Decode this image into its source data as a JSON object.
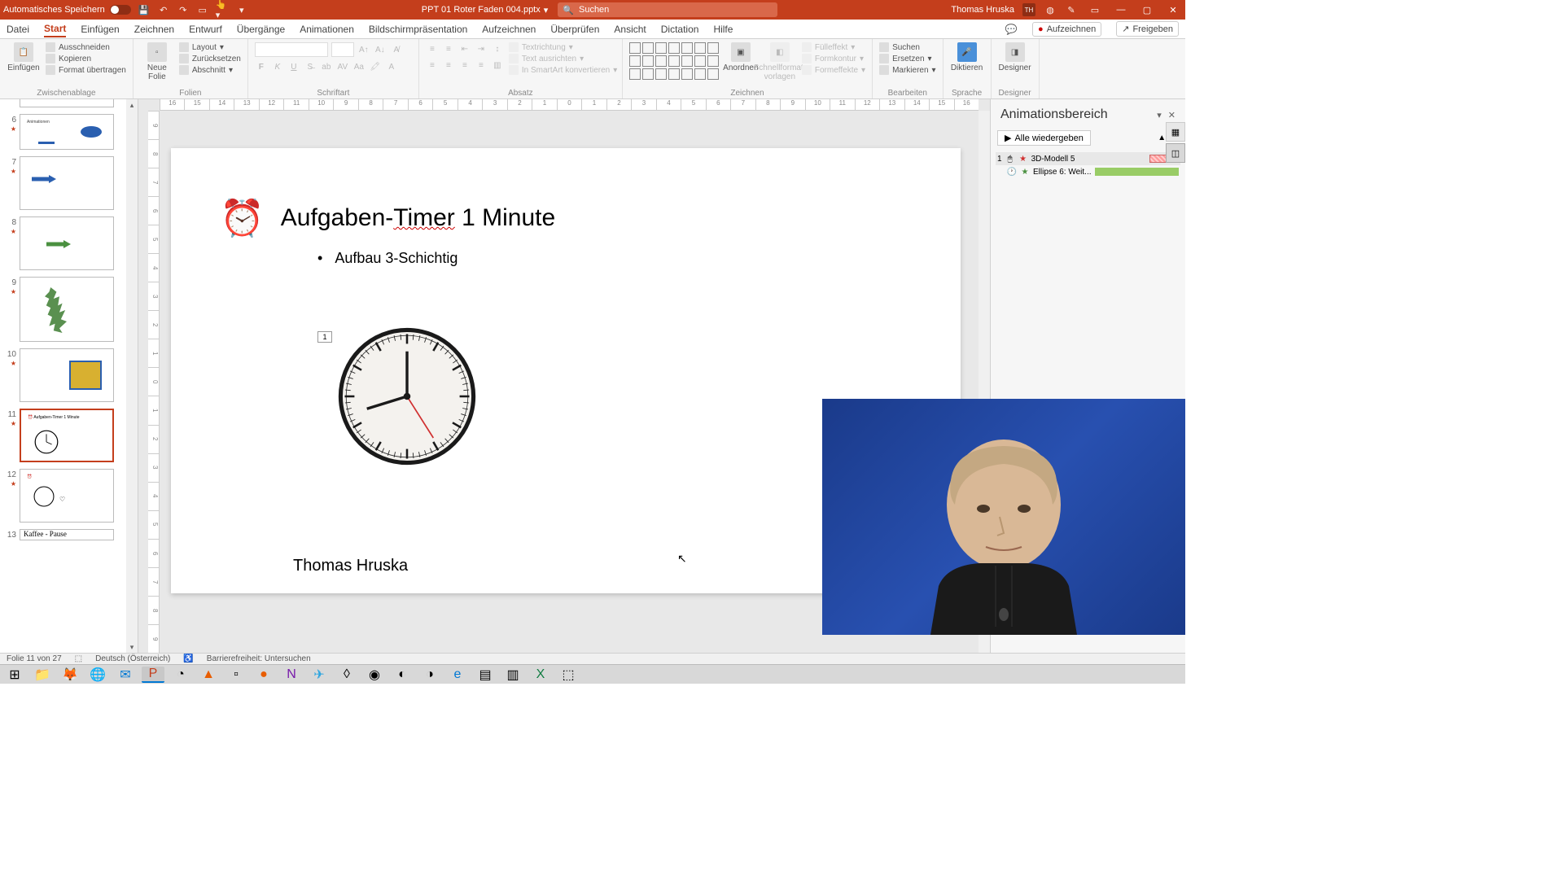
{
  "titlebar": {
    "autosave_label": "Automatisches Speichern",
    "filename": "PPT 01 Roter Faden 004.pptx",
    "search_placeholder": "Suchen",
    "username": "Thomas Hruska",
    "user_initials": "TH"
  },
  "tabs": {
    "items": [
      "Datei",
      "Start",
      "Einfügen",
      "Zeichnen",
      "Entwurf",
      "Übergänge",
      "Animationen",
      "Bildschirmpräsentation",
      "Aufzeichnen",
      "Überprüfen",
      "Ansicht",
      "Dictation",
      "Hilfe"
    ],
    "active_index": 1,
    "record_btn": "Aufzeichnen",
    "share_btn": "Freigeben"
  },
  "ribbon": {
    "clipboard": {
      "label": "Zwischenablage",
      "paste": "Einfügen",
      "cut": "Ausschneiden",
      "copy": "Kopieren",
      "format": "Format übertragen"
    },
    "slides": {
      "label": "Folien",
      "new_slide": "Neue Folie",
      "layout": "Layout",
      "reset": "Zurücksetzen",
      "section": "Abschnitt"
    },
    "font": {
      "label": "Schriftart"
    },
    "paragraph": {
      "label": "Absatz",
      "textdir": "Textrichtung",
      "align": "Text ausrichten",
      "smartart": "In SmartArt konvertieren"
    },
    "drawing": {
      "label": "Zeichnen",
      "arrange": "Anordnen",
      "quickstyles": "Schnellformat-vorlagen",
      "fill": "Fülleffekt",
      "outline": "Formkontur",
      "effects": "Formeffekte"
    },
    "editing": {
      "label": "Bearbeiten",
      "find": "Suchen",
      "replace": "Ersetzen",
      "select": "Markieren"
    },
    "voice": {
      "label": "Sprache",
      "dictate": "Diktieren"
    },
    "designer": {
      "label": "Designer",
      "btn": "Designer"
    }
  },
  "ruler_h": [
    "16",
    "15",
    "14",
    "13",
    "12",
    "11",
    "10",
    "9",
    "8",
    "7",
    "6",
    "5",
    "4",
    "3",
    "2",
    "1",
    "0",
    "1",
    "2",
    "3",
    "4",
    "5",
    "6",
    "7",
    "8",
    "9",
    "10",
    "11",
    "12",
    "13",
    "14",
    "15",
    "16"
  ],
  "ruler_v": [
    "9",
    "8",
    "7",
    "6",
    "5",
    "4",
    "3",
    "2",
    "1",
    "0",
    "1",
    "2",
    "3",
    "4",
    "5",
    "6",
    "7",
    "8",
    "9"
  ],
  "thumbnails": [
    {
      "num": "6"
    },
    {
      "num": "7"
    },
    {
      "num": "8"
    },
    {
      "num": "9"
    },
    {
      "num": "10"
    },
    {
      "num": "11",
      "active": true
    },
    {
      "num": "12"
    },
    {
      "num": "13",
      "text": "Kaffee - Pause"
    }
  ],
  "slide": {
    "title_pre": "Aufgaben-",
    "title_underlined": "Timer",
    "title_post": " 1 Minute",
    "bullet": "Aufbau 3-Schichtig",
    "anim_tag": "1",
    "author": "Thomas Hruska"
  },
  "anim_pane": {
    "title": "Animationsbereich",
    "play_all": "Alle wiedergeben",
    "entries": [
      {
        "num": "1",
        "name": "3D-Modell 5",
        "color": "red"
      },
      {
        "name": "Ellipse 6: Weit...",
        "color": "green"
      }
    ]
  },
  "statusbar": {
    "slide_pos": "Folie 11 von 27",
    "language": "Deutsch (Österreich)",
    "a11y": "Barrierefreiheit: Untersuchen"
  }
}
